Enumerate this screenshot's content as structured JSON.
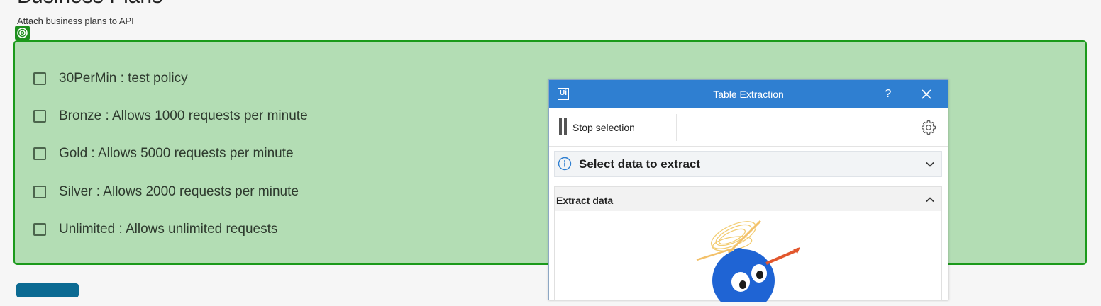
{
  "page": {
    "title": "Business Plans",
    "subtitle": "Attach business plans to API"
  },
  "plans": [
    {
      "label": "30PerMin : test policy",
      "checked": false
    },
    {
      "label": "Bronze : Allows 1000 requests per minute",
      "checked": false
    },
    {
      "label": "Gold : Allows 5000 requests per minute",
      "checked": false
    },
    {
      "label": "Silver : Allows 2000 requests per minute",
      "checked": false
    },
    {
      "label": "Unlimited : Allows unlimited requests",
      "checked": false
    }
  ],
  "dialog": {
    "logo": "Ui",
    "title": "Table Extraction",
    "help": "?",
    "toolbar": {
      "stop_selection": "Stop selection"
    },
    "sections": {
      "select_data": "Select data to extract",
      "extract_data": "Extract data"
    }
  },
  "icons": {
    "target": "target-icon",
    "pause": "pause-icon",
    "gear": "gear-icon",
    "info": "info-icon",
    "close": "close-icon",
    "chevron_down": "chevron-down-icon",
    "chevron_up": "chevron-up-icon"
  },
  "colors": {
    "selection_fill": "#b3ddb4",
    "selection_border": "#1b9a1b",
    "dialog_titlebar": "#2f7fd1",
    "primary_button": "#0b6a92"
  }
}
